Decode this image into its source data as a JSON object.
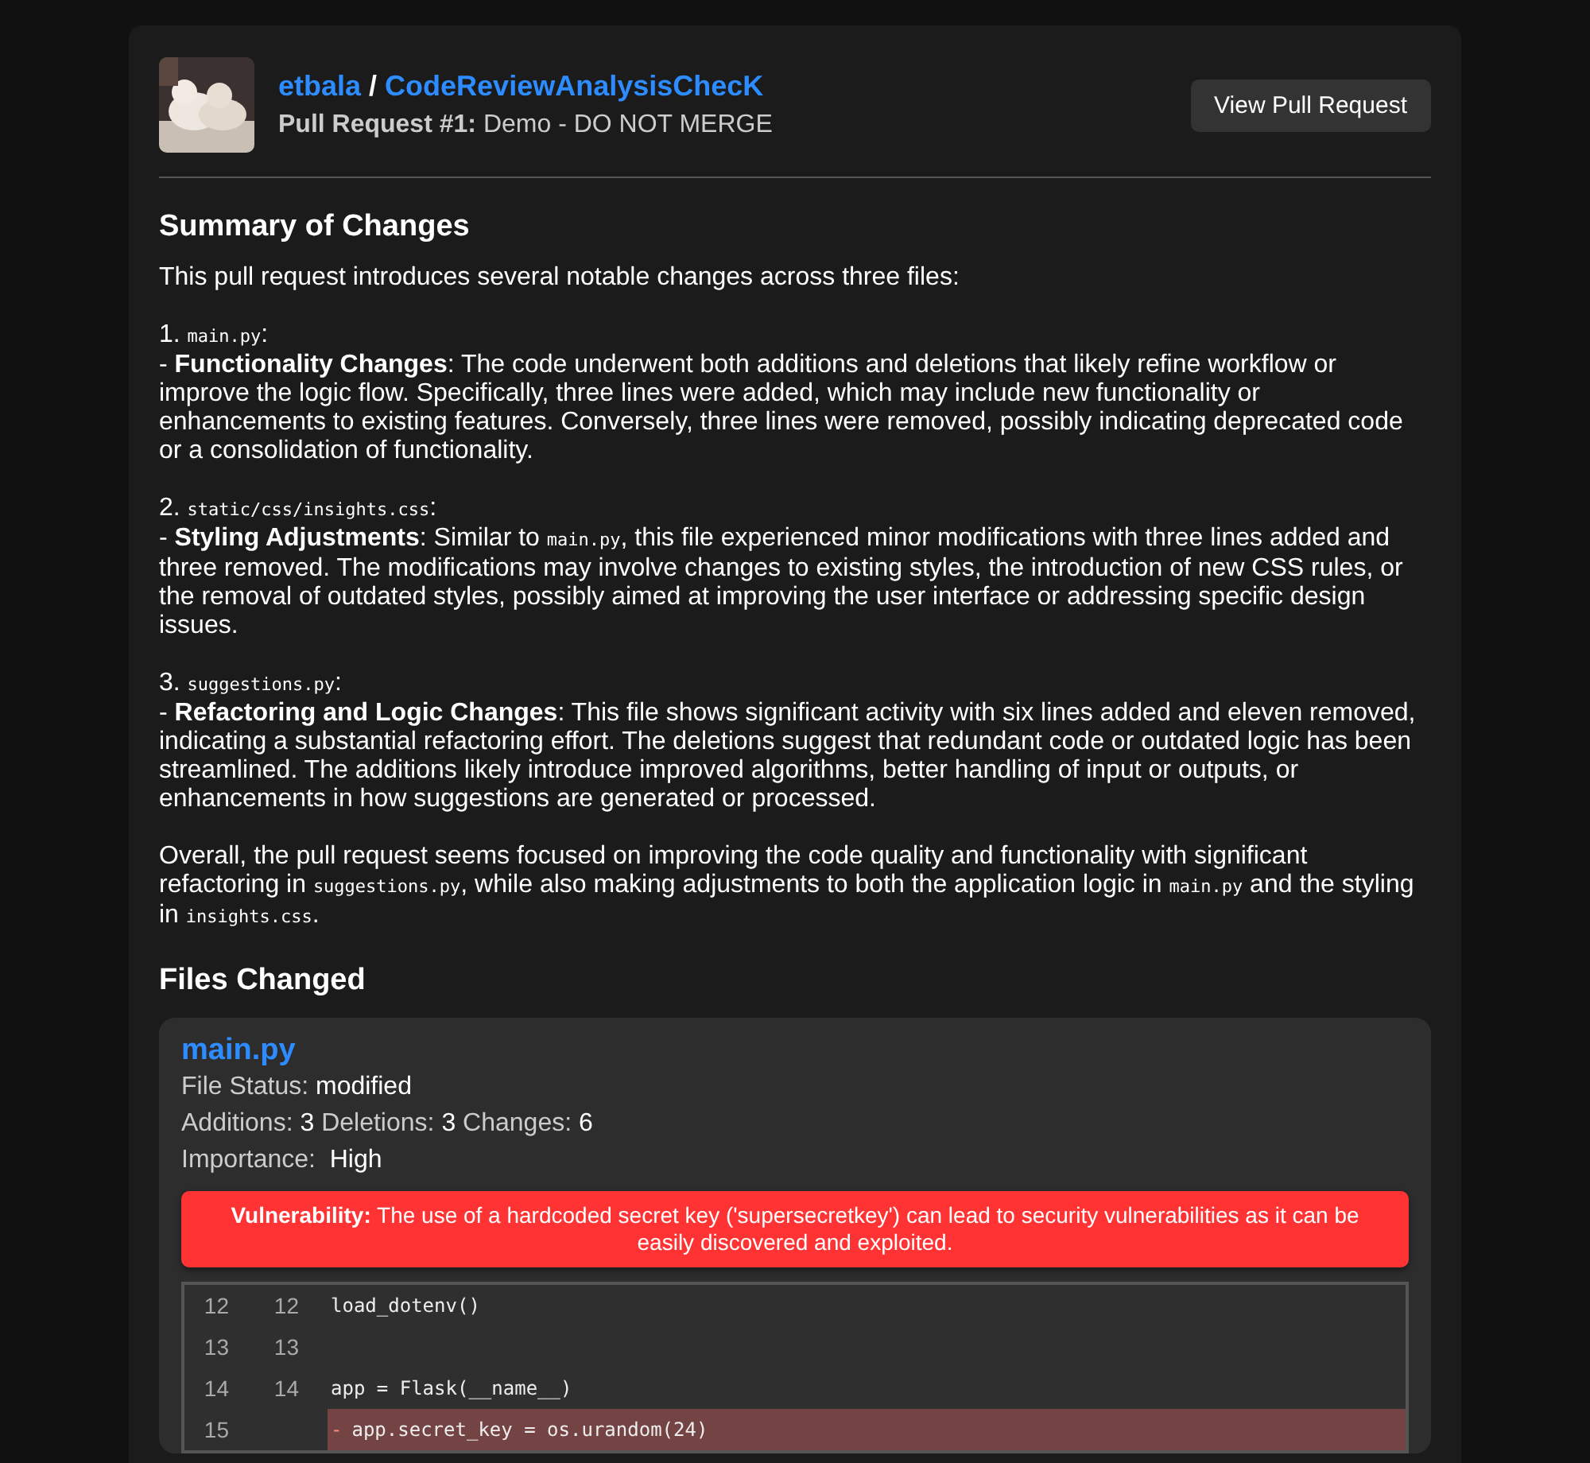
{
  "header": {
    "owner": "etbala",
    "separator": "/",
    "repo": "CodeReviewAnalysisChecK",
    "pr_label": "Pull Request #1:",
    "pr_title": "Demo - DO NOT MERGE",
    "button": "View Pull Request"
  },
  "summary": {
    "title": "Summary of Changes",
    "blocks": [
      [
        [
          {
            "kind": "text",
            "text": "This pull request introduces several notable changes across three files:"
          }
        ]
      ],
      [
        [
          {
            "kind": "text",
            "text": "1. "
          },
          {
            "kind": "code",
            "text": "main.py"
          },
          {
            "kind": "text",
            "text": ":"
          }
        ],
        [
          {
            "kind": "text",
            "text": "- **Functionality Changes**: The code underwent both additions and deletions that likely refine workflow or improve the logic flow. Specifically, three lines were added, which may include new functionality or enhancements to existing features. Conversely, three lines were removed, possibly indicating deprecated code or a consolidation of functionality."
          }
        ]
      ],
      [
        [
          {
            "kind": "text",
            "text": "2. "
          },
          {
            "kind": "code",
            "text": "static/css/insights.css"
          },
          {
            "kind": "text",
            "text": ":"
          }
        ],
        [
          {
            "kind": "text",
            "text": "- **Styling Adjustments**: Similar to "
          },
          {
            "kind": "code",
            "text": "main.py"
          },
          {
            "kind": "text",
            "text": ", this file experienced minor modifications with three lines added and three removed. The modifications may involve changes to existing styles, the introduction of new CSS rules, or the removal of outdated styles, possibly aimed at improving the user interface or addressing specific design issues."
          }
        ]
      ],
      [
        [
          {
            "kind": "text",
            "text": "3. "
          },
          {
            "kind": "code",
            "text": "suggestions.py"
          },
          {
            "kind": "text",
            "text": ":"
          }
        ],
        [
          {
            "kind": "text",
            "text": "- **Refactoring and Logic Changes**: This file shows significant activity with six lines added and eleven removed, indicating a substantial refactoring effort. The deletions suggest that redundant code or outdated logic has been streamlined. The additions likely introduce improved algorithms, better handling of input or outputs, or enhancements in how suggestions are generated or processed."
          }
        ]
      ],
      [
        [
          {
            "kind": "text",
            "text": "Overall, the pull request seems focused on improving the code quality and functionality with significant refactoring in "
          },
          {
            "kind": "code",
            "text": "suggestions.py"
          },
          {
            "kind": "text",
            "text": ", while also making adjustments to both the application logic in "
          },
          {
            "kind": "code",
            "text": "main.py"
          },
          {
            "kind": "text",
            "text": " and the styling in "
          },
          {
            "kind": "code",
            "text": "insights.css"
          },
          {
            "kind": "text",
            "text": "."
          }
        ]
      ]
    ]
  },
  "files_title": "Files Changed",
  "files": [
    {
      "name": "main.py",
      "status_label": "File Status:",
      "status": "modified",
      "stats": [
        {
          "label": "Additions:",
          "value": "3"
        },
        {
          "label": "Deletions:",
          "value": "3"
        },
        {
          "label": "Changes:",
          "value": "6"
        }
      ],
      "importance_label": "Importance:",
      "importance": "High",
      "alert": {
        "label": "Vulnerability:",
        "text": "The use of a hardcoded secret key ('supersecretkey') can lead to security vulnerabilities as it can be easily discovered and exploited."
      },
      "lines": [
        {
          "kind": "context",
          "old": "12",
          "new": "12",
          "code": "load_dotenv()"
        },
        {
          "kind": "context",
          "old": "13",
          "new": "13"
        },
        {
          "kind": "context",
          "old": "14",
          "new": "14",
          "code": "app = Flask(__name__)"
        },
        {
          "kind": "removed",
          "old": "15",
          "marker": "-",
          "code": "app.secret_key = os.urandom(24)"
        }
      ]
    }
  ]
}
